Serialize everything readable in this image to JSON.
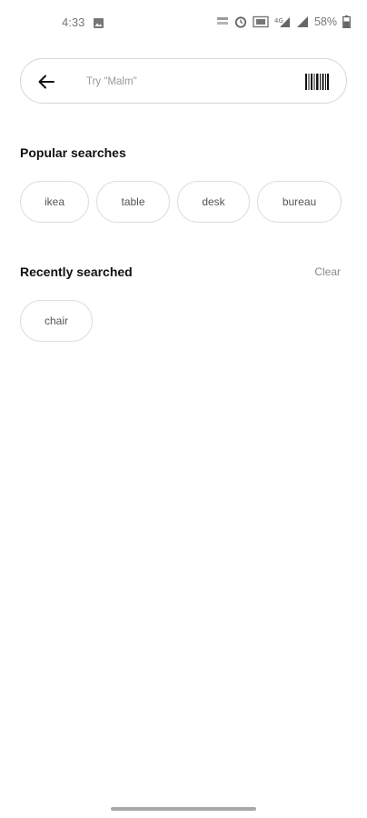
{
  "status_bar": {
    "time": "4:33",
    "battery": "58%",
    "icons": [
      "image-icon",
      "nfc-icon",
      "alarm-icon",
      "vibrate-icon",
      "wifi-signal-icon",
      "cell-signal-icon",
      "battery-icon"
    ]
  },
  "search": {
    "placeholder": "Try \"Malm\"",
    "value": "",
    "back_icon": "arrow-left-icon",
    "scan_icon": "barcode-icon"
  },
  "popular": {
    "title": "Popular searches",
    "chips": [
      {
        "label": "ikea"
      },
      {
        "label": "table"
      },
      {
        "label": "desk"
      },
      {
        "label": "bureau"
      }
    ]
  },
  "recent": {
    "title": "Recently searched",
    "clear_label": "Clear",
    "chips": [
      {
        "label": "chair"
      }
    ]
  },
  "colors": {
    "background": "#ffffff",
    "border": "#d6d6d6",
    "text_primary": "#111111",
    "text_muted": "#8a8a8a"
  }
}
